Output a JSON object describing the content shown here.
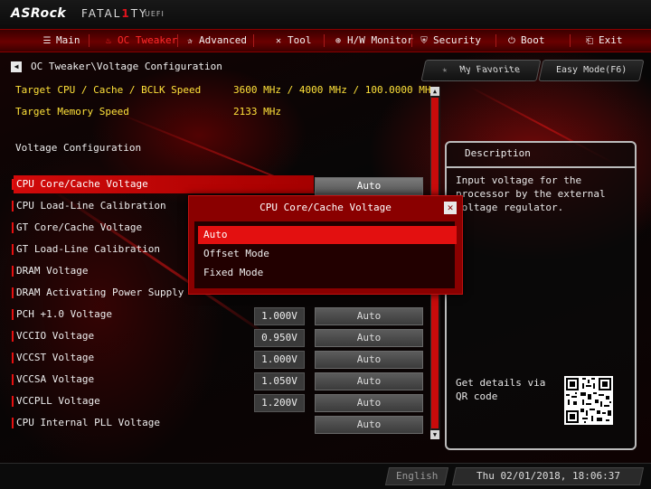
{
  "brand": {
    "logo": "ASRock",
    "product_prefix": "FATAL",
    "product_highlight": "1",
    "product_suffix": "TY",
    "uefi": "UEFI"
  },
  "nav": [
    {
      "label": "Main",
      "icon": "list-icon",
      "glyph": "☰"
    },
    {
      "label": "OC Tweaker",
      "icon": "flame-icon",
      "glyph": "🔥",
      "active": true
    },
    {
      "label": "Advanced",
      "icon": "star-icon",
      "glyph": "✰"
    },
    {
      "label": "Tool",
      "icon": "tool-icon",
      "glyph": "✕"
    },
    {
      "label": "H/W Monitor",
      "icon": "monitor-icon",
      "glyph": "⊕"
    },
    {
      "label": "Security",
      "icon": "shield-icon",
      "glyph": "⛨"
    },
    {
      "label": "Boot",
      "icon": "power-icon",
      "glyph": "⏻"
    },
    {
      "label": "Exit",
      "icon": "exit-icon",
      "glyph": "⎗"
    }
  ],
  "breadcrumb": "OC Tweaker\\Voltage Configuration",
  "buttons": {
    "favorite": "My Favorite",
    "easy_mode": "Easy Mode(F6)"
  },
  "info": [
    {
      "label": "Target CPU / Cache / BCLK Speed",
      "value": "3600 MHz / 4000 MHz / 100.0000 MHz"
    },
    {
      "label": "Target Memory Speed",
      "value": "2133 MHz"
    }
  ],
  "section_title": "Voltage Configuration",
  "settings": [
    {
      "label": "CPU Core/Cache Voltage",
      "num": "",
      "option": "Auto",
      "selected": true
    },
    {
      "label": "CPU Load-Line Calibration",
      "num": "",
      "option": ""
    },
    {
      "label": "GT Core/Cache Voltage",
      "num": "",
      "option": ""
    },
    {
      "label": "GT Load-Line Calibration",
      "num": "",
      "option": ""
    },
    {
      "label": "DRAM Voltage",
      "num": "",
      "option": ""
    },
    {
      "label": "DRAM Activating Power Supply",
      "num": "",
      "option": ""
    },
    {
      "label": "PCH +1.0 Voltage",
      "num": "1.000V",
      "option": "Auto"
    },
    {
      "label": "VCCIO Voltage",
      "num": "0.950V",
      "option": "Auto"
    },
    {
      "label": "VCCST Voltage",
      "num": "1.000V",
      "option": "Auto"
    },
    {
      "label": "VCCSA Voltage",
      "num": "1.050V",
      "option": "Auto"
    },
    {
      "label": "VCCPLL Voltage",
      "num": "1.200V",
      "option": "Auto"
    },
    {
      "label": "CPU Internal PLL Voltage",
      "num": "",
      "option": "Auto"
    }
  ],
  "description": {
    "title": "Description",
    "text": "Input voltage for the processor by the external voltage regulator.",
    "qr_label": "Get details via QR code"
  },
  "modal": {
    "title": "CPU Core/Cache Voltage",
    "options": [
      "Auto",
      "Offset Mode",
      "Fixed Mode"
    ],
    "selected_index": 0
  },
  "footer": {
    "language": "English",
    "datetime": "Thu 02/01/2018, 18:06:37"
  },
  "colors": {
    "accent": "#e31010",
    "info_text": "#ffe23a",
    "nav_bg": "#6a0000"
  }
}
